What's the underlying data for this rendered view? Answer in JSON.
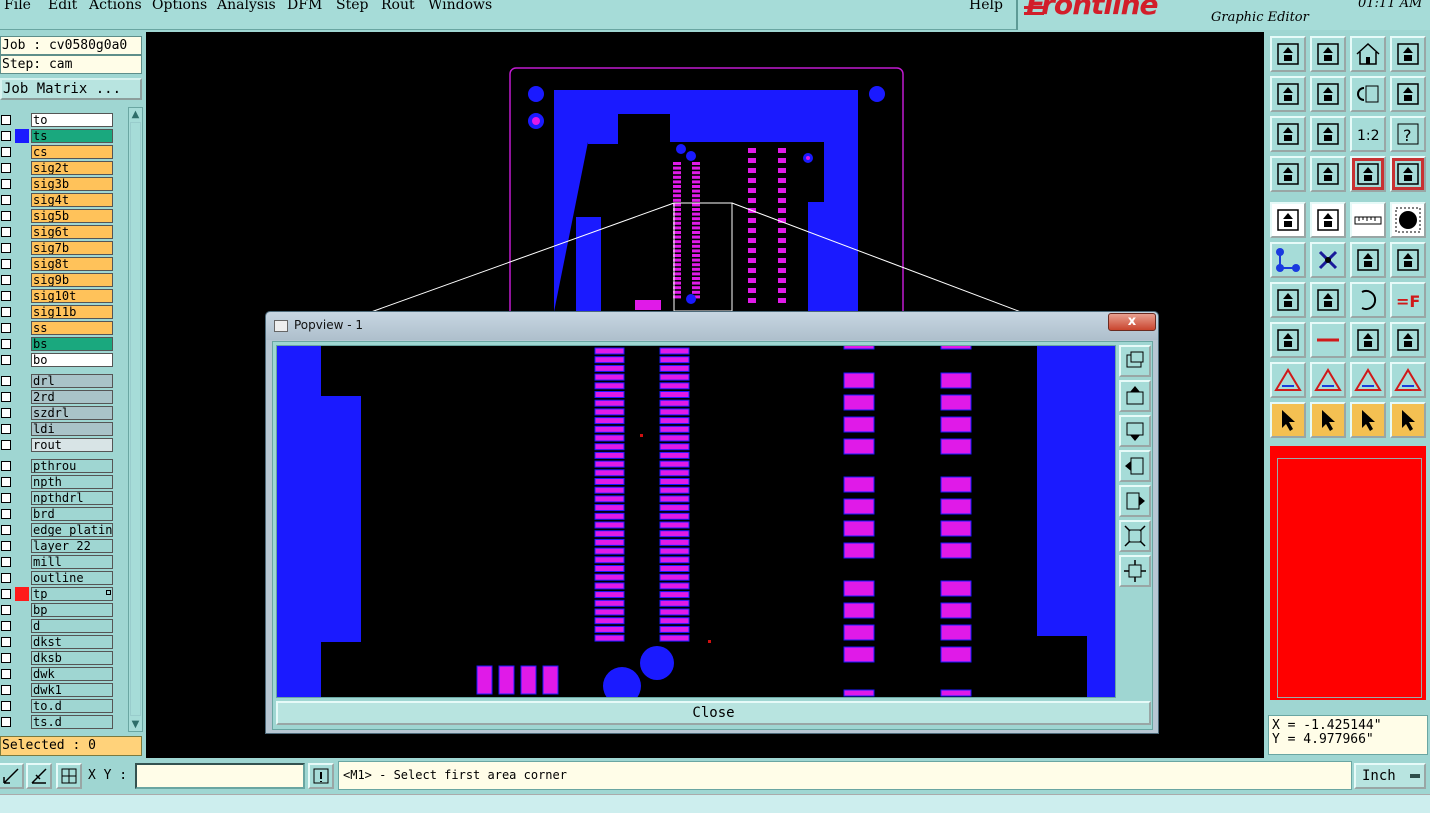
{
  "menu": {
    "items": [
      "File",
      "Edit",
      "Actions",
      "Options",
      "Analysis",
      "DFM",
      "Step",
      "Rout",
      "Windows"
    ],
    "help": "Help"
  },
  "brand": {
    "logo": "Frontline",
    "subtitle": "Graphic Editor",
    "clock": "01:11 AM"
  },
  "left_panel": {
    "job": "Job : cv0580g0a0",
    "step": "Step: cam",
    "job_matrix": "Job Matrix ...",
    "selected": "Selected : 0"
  },
  "layers": [
    {
      "name": "to",
      "color": "#ffffff",
      "swatch": ""
    },
    {
      "name": "ts",
      "color": "#1aa87e",
      "swatch": "#1a1aff"
    },
    {
      "name": "cs",
      "color": "#ffc25a",
      "swatch": ""
    },
    {
      "name": "sig2t",
      "color": "#ffc25a",
      "swatch": ""
    },
    {
      "name": "sig3b",
      "color": "#ffc25a",
      "swatch": ""
    },
    {
      "name": "sig4t",
      "color": "#ffc25a",
      "swatch": ""
    },
    {
      "name": "sig5b",
      "color": "#ffc25a",
      "swatch": ""
    },
    {
      "name": "sig6t",
      "color": "#ffc25a",
      "swatch": ""
    },
    {
      "name": "sig7b",
      "color": "#ffc25a",
      "swatch": ""
    },
    {
      "name": "sig8t",
      "color": "#ffc25a",
      "swatch": ""
    },
    {
      "name": "sig9b",
      "color": "#ffc25a",
      "swatch": ""
    },
    {
      "name": "sig10t",
      "color": "#ffc25a",
      "swatch": ""
    },
    {
      "name": "sig11b",
      "color": "#ffc25a",
      "swatch": ""
    },
    {
      "name": "ss",
      "color": "#ffc25a",
      "swatch": ""
    },
    {
      "name": "bs",
      "color": "#1aa87e",
      "swatch": ""
    },
    {
      "name": "bo",
      "color": "#ffffff",
      "swatch": ""
    },
    {
      "name": "drl",
      "color": "#a9c3c8",
      "swatch": ""
    },
    {
      "name": "2rd",
      "color": "#a9c3c8",
      "swatch": ""
    },
    {
      "name": "szdrl",
      "color": "#a9c3c8",
      "swatch": ""
    },
    {
      "name": "ldi",
      "color": "#a9c3c8",
      "swatch": ""
    },
    {
      "name": "rout",
      "color": "#d8e4e6",
      "swatch": ""
    },
    {
      "name": "pthrou",
      "color": "#9fd6d2",
      "swatch": ""
    },
    {
      "name": "npth",
      "color": "#9fd6d2",
      "swatch": ""
    },
    {
      "name": "npthdrl",
      "color": "#9fd6d2",
      "swatch": ""
    },
    {
      "name": "brd",
      "color": "#9fd6d2",
      "swatch": ""
    },
    {
      "name": "edge_plating",
      "color": "#9fd6d2",
      "swatch": ""
    },
    {
      "name": "layer_22",
      "color": "#9fd6d2",
      "swatch": ""
    },
    {
      "name": "mill",
      "color": "#9fd6d2",
      "swatch": ""
    },
    {
      "name": "outline",
      "color": "#9fd6d2",
      "swatch": ""
    },
    {
      "name": "tp",
      "color": "#9fd6d2",
      "swatch": "#ff1a1a"
    },
    {
      "name": "bp",
      "color": "#9fd6d2",
      "swatch": ""
    },
    {
      "name": "d",
      "color": "#9fd6d2",
      "swatch": ""
    },
    {
      "name": "dkst",
      "color": "#9fd6d2",
      "swatch": ""
    },
    {
      "name": "dksb",
      "color": "#9fd6d2",
      "swatch": ""
    },
    {
      "name": "dwk",
      "color": "#9fd6d2",
      "swatch": ""
    },
    {
      "name": "dwk1",
      "color": "#9fd6d2",
      "swatch": ""
    },
    {
      "name": "to.d",
      "color": "#9fd6d2",
      "swatch": ""
    },
    {
      "name": "ts.d",
      "color": "#9fd6d2",
      "swatch": ""
    }
  ],
  "colors": {
    "copper": "#1a1aff",
    "pad": "#e01ae8",
    "outline": "#c01ad0",
    "background": "#000000",
    "panel": "#9fd6d2"
  },
  "toolbar_icons": [
    "open-job-icon",
    "save-icon",
    "home-icon",
    "window-icon",
    "pan-left-icon",
    "pan-right-icon",
    "undo-icon",
    "redraw-icon",
    "zoom-fit-icon",
    "zoom-center-icon",
    "scale-icon",
    "help-icon",
    "settings-icon",
    "measure-pin-icon",
    "layer-red-icon",
    "layer-red2-icon",
    "feature-add-icon",
    "feature-select-icon",
    "ruler-icon",
    "circle-icon",
    "connect-icon",
    "cross-icon",
    "arc-icon",
    "line-icon",
    "angle-icon",
    "draw-line-icon",
    "rotate-icon",
    "mirror-icon",
    "pad-icon",
    "minus-icon",
    "dimension-icon",
    "copy-icon",
    "triangle-icon",
    "triangle2-icon",
    "triangle3-icon",
    "triangle4-icon",
    "pointer-icon",
    "pointer-box-icon",
    "pointer-circle-icon",
    "pointer-step-icon"
  ],
  "coords": {
    "x": "X = -1.425144\"",
    "y": "Y = 4.977966\""
  },
  "status": {
    "xy_label": "X Y :",
    "xy_value": "",
    "message": "<M1> - Select first area corner",
    "unit": "Inch"
  },
  "popview": {
    "title": "Popview - 1",
    "close": "Close",
    "close_x": "x"
  }
}
